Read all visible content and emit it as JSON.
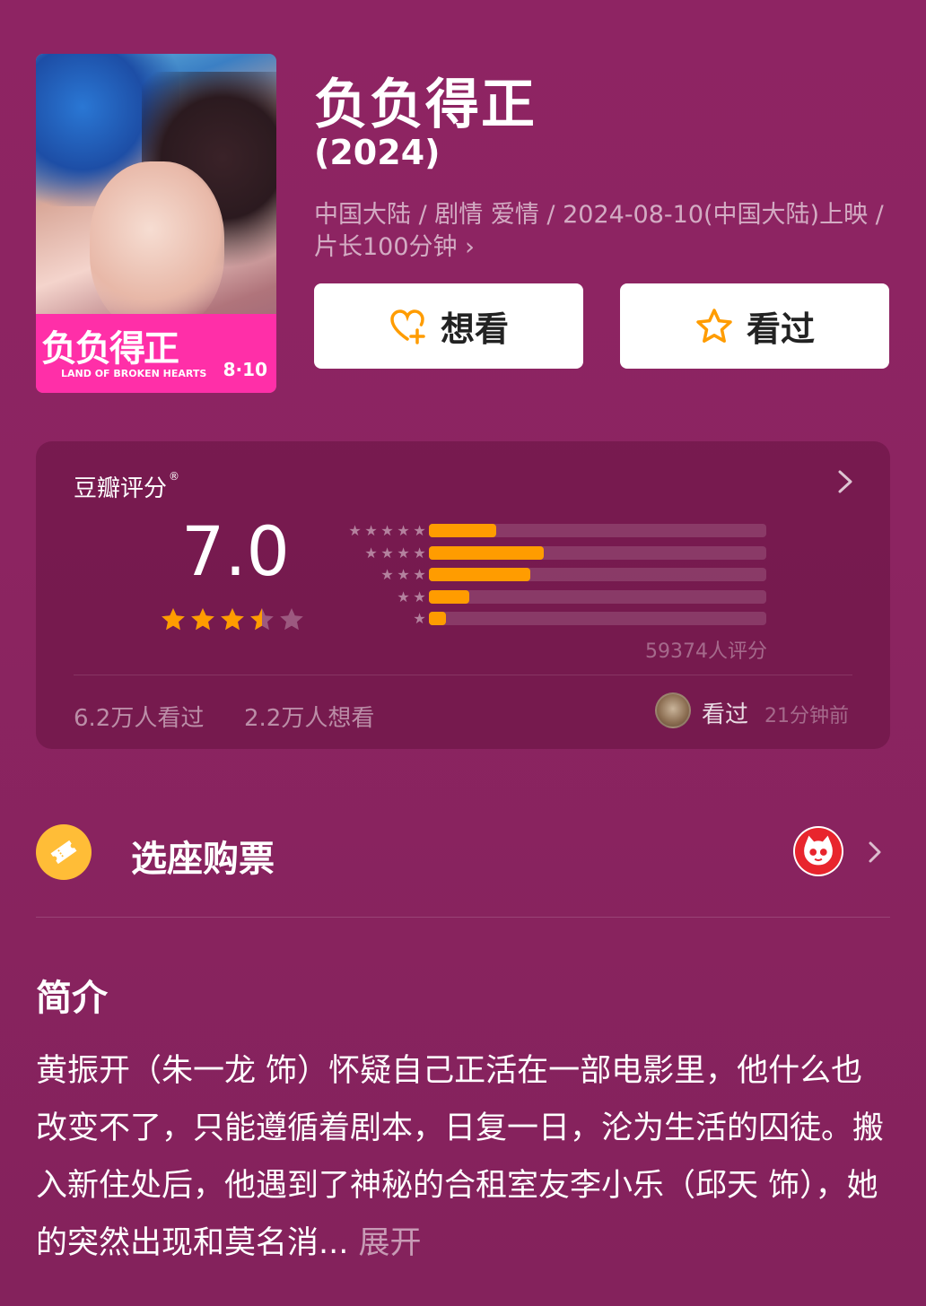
{
  "movie": {
    "title": "负负得正",
    "year": "(2024)",
    "meta": "中国大陆 / 剧情 爱情 / 2024-08-10(中国大陆)上映 / 片长100分钟 ›",
    "poster": {
      "title_art": "负负得正",
      "english_title": "LAND OF BROKEN HEARTS",
      "date": "8·10"
    }
  },
  "actions": {
    "want_label": "想看",
    "seen_label": "看过"
  },
  "rating": {
    "title": "豆瓣评分",
    "registered_mark": "®",
    "score": "7.0",
    "stars_value": 3.5,
    "stars_max": 5,
    "count_text": "59374人评分",
    "distribution": [
      {
        "stars": 5,
        "fraction": 0.2
      },
      {
        "stars": 4,
        "fraction": 0.34
      },
      {
        "stars": 3,
        "fraction": 0.3
      },
      {
        "stars": 2,
        "fraction": 0.12
      },
      {
        "stars": 1,
        "fraction": 0.05
      }
    ],
    "seen_count": "6.2万人看过",
    "want_count": "2.2万人想看",
    "friend_action": "看过",
    "friend_time": "21分钟前"
  },
  "ticket": {
    "label": "选座购票"
  },
  "synopsis": {
    "title": "简介",
    "text": "黄振开（朱一龙 饰）怀疑自己正活在一部电影里，他什么也改变不了，只能遵循着剧本，日复一日，沦为生活的囚徒。搬入新住处后，他遇到了神秘的合租室友李小乐（邱天 饰），她的突然出现和莫名消...",
    "expand": "展开"
  },
  "colors": {
    "background": "#8c2461",
    "bar_fill": "#ff9c00",
    "star": "#ff9c00",
    "ticket_icon": "#ffbd37"
  }
}
